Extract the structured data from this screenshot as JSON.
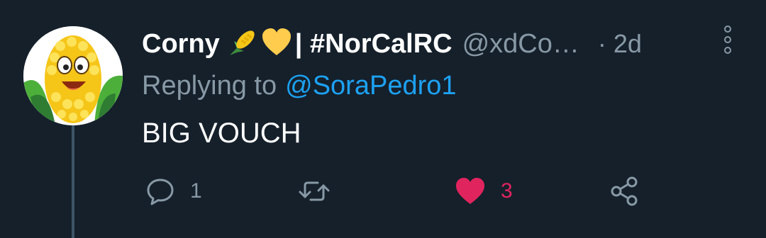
{
  "tweet": {
    "display_name": "Corny",
    "name_suffix": "| #NorCalRC",
    "handle": "@xdCo…",
    "time": "· 2d",
    "reply_prefix": "Replying to",
    "reply_to": "@SoraPedro1",
    "text": "BIG VOUCH"
  },
  "icons": {
    "name_emojis": [
      "corn-emoji",
      "yellow-heart-emoji"
    ],
    "more": "vertical-dots-icon"
  },
  "actions": {
    "reply": {
      "icon": "comment-icon",
      "count": "1"
    },
    "retweet": {
      "icon": "retweet-icon",
      "count": ""
    },
    "like": {
      "icon": "heart-icon",
      "count": "3",
      "liked": true
    },
    "share": {
      "icon": "share-icon"
    }
  },
  "colors": {
    "background": "#15202b",
    "text": "#ffffff",
    "muted": "#8899a6",
    "mention": "#1da1f2",
    "like": "#e0245e",
    "thread_line": "#3d5466"
  }
}
